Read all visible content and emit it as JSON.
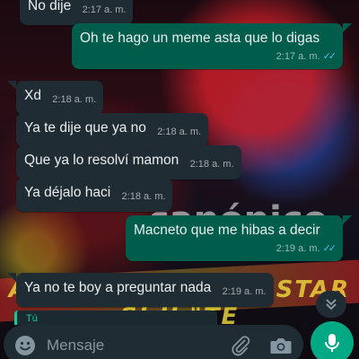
{
  "messages": [
    {
      "dir": "in",
      "text": "No dije",
      "time": "2:17 a. m."
    },
    {
      "dir": "out",
      "text": "Oh te hago un meme asta que lo digas",
      "time": "2:17 a. m.",
      "status": "read"
    },
    {
      "dir": "in",
      "text": "Xd",
      "time": "2:18 a. m."
    },
    {
      "dir": "in",
      "text": "Ya te dije que ya no",
      "time": "2:18 a. m."
    },
    {
      "dir": "in",
      "text": "Que ya lo resolví mamon",
      "time": "2:18 a. m."
    },
    {
      "dir": "in",
      "text": "Ya déjalo haci",
      "time": "2:18 a. m."
    },
    {
      "dir": "out",
      "text": "Macneto que me hibas a decir",
      "time": "2:19 a. m.",
      "status": "read"
    },
    {
      "dir": "in",
      "text": "Ya no te boy a preguntar  nada",
      "time": "2:19 a. m."
    }
  ],
  "reply_preview": {
    "text": "Tú"
  },
  "wallpaper": {
    "line1": "nto",
    "line2": "canónico",
    "band": "A AQUÍ HAY QUE ESTAR SI U \"TE"
  },
  "composer": {
    "placeholder": "Mensaje"
  },
  "icons": {
    "emoji": "emoji-icon",
    "attach": "paperclip-icon",
    "camera": "camera-icon",
    "mic": "microphone-icon",
    "scroll": "chevron-double-down-icon",
    "read": "double-check-icon"
  },
  "colors": {
    "incoming": "#202c33",
    "outgoing": "#005c4b",
    "accent": "#00a884",
    "read_ticks": "#53bdeb"
  }
}
